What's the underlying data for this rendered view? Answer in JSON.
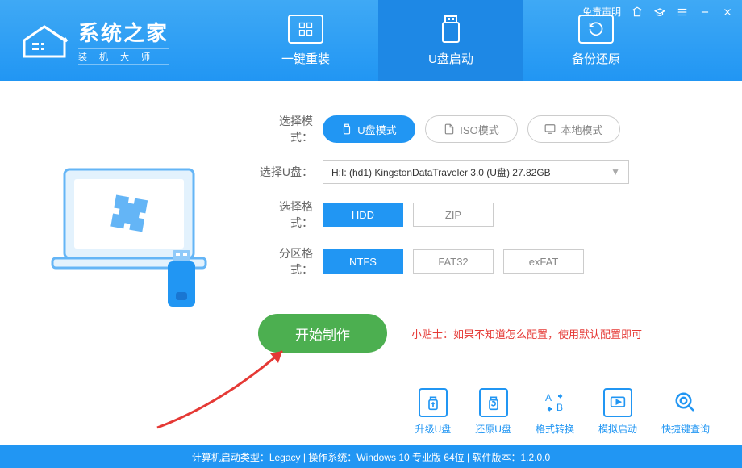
{
  "topbar": {
    "disclaimer": "免责声明"
  },
  "logo": {
    "title": "系统之家",
    "subtitle": "装 机 大 师"
  },
  "tabs": [
    {
      "label": "一键重装",
      "active": false
    },
    {
      "label": "U盘启动",
      "active": true
    },
    {
      "label": "备份还原",
      "active": false
    }
  ],
  "form": {
    "modeLabel": "选择模式：",
    "modes": [
      {
        "label": "U盘模式",
        "active": true
      },
      {
        "label": "ISO模式",
        "active": false
      },
      {
        "label": "本地模式",
        "active": false
      }
    ],
    "usbLabel": "选择U盘：",
    "usbSelected": "H:I: (hd1) KingstonDataTraveler 3.0 (U盘) 27.82GB",
    "formatLabel": "选择格式：",
    "formats": [
      {
        "label": "HDD",
        "active": true
      },
      {
        "label": "ZIP",
        "active": false
      }
    ],
    "partitionLabel": "分区格式：",
    "partitions": [
      {
        "label": "NTFS",
        "active": true
      },
      {
        "label": "FAT32",
        "active": false
      },
      {
        "label": "exFAT",
        "active": false
      }
    ],
    "startBtn": "开始制作",
    "tip": "小贴士：如果不知道怎么配置，使用默认配置即可"
  },
  "tools": [
    {
      "label": "升级U盘"
    },
    {
      "label": "还原U盘"
    },
    {
      "label": "格式转换"
    },
    {
      "label": "模拟启动"
    },
    {
      "label": "快捷键查询"
    }
  ],
  "statusBar": "计算机启动类型：Legacy | 操作系统：Windows 10 专业版 64位 | 软件版本：1.2.0.0"
}
